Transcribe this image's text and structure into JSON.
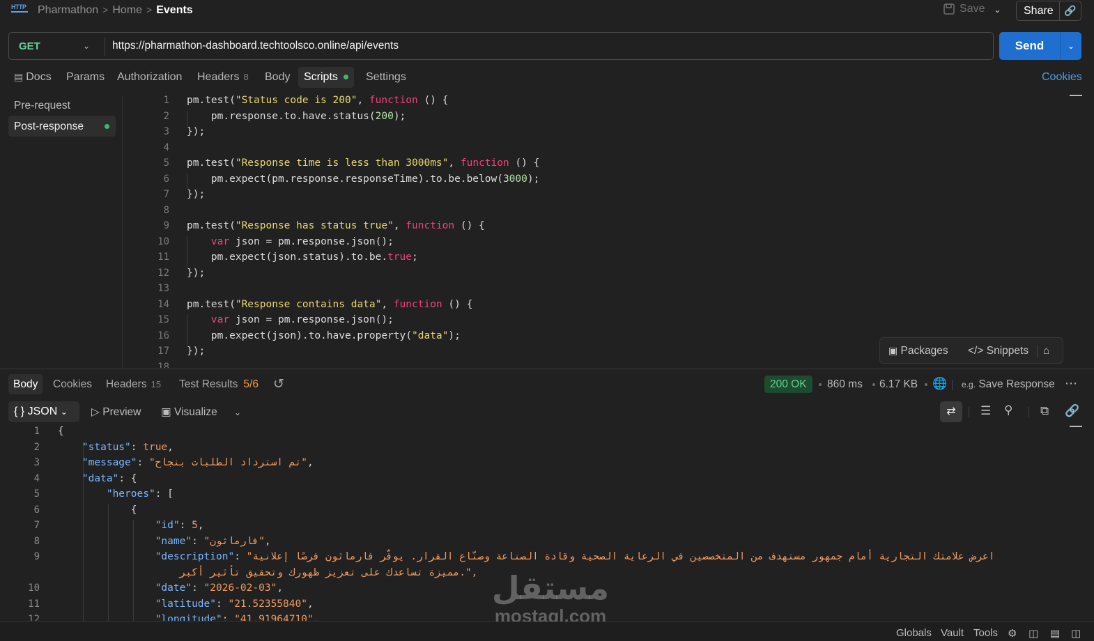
{
  "header": {
    "breadcrumb": [
      "Pharmathon",
      "Home",
      "Events"
    ],
    "save_label": "Save",
    "share_label": "Share"
  },
  "request": {
    "method": "GET",
    "url": "https://pharmathon-dashboard.techtoolsco.online/api/events",
    "send_label": "Send"
  },
  "tabs": {
    "docs": "Docs",
    "params": "Params",
    "authorization": "Authorization",
    "headers": "Headers",
    "headers_count": "8",
    "body": "Body",
    "scripts": "Scripts",
    "settings": "Settings",
    "cookies": "Cookies"
  },
  "scripts_sidebar": {
    "pre": "Pre-request",
    "post": "Post-response"
  },
  "editor_tools": {
    "packages": "Packages",
    "snippets": "Snippets"
  },
  "code_lines": [
    {
      "n": "1",
      "text": "pm.test(\"Status code is 200\", function () {"
    },
    {
      "n": "2",
      "text": "    pm.response.to.have.status(200);"
    },
    {
      "n": "3",
      "text": "});"
    },
    {
      "n": "4",
      "text": ""
    },
    {
      "n": "5",
      "text": "pm.test(\"Response time is less than 3000ms\", function () {"
    },
    {
      "n": "6",
      "text": "    pm.expect(pm.response.responseTime).to.be.below(3000);"
    },
    {
      "n": "7",
      "text": "});"
    },
    {
      "n": "8",
      "text": ""
    },
    {
      "n": "9",
      "text": "pm.test(\"Response has status true\", function () {"
    },
    {
      "n": "10",
      "text": "    var json = pm.response.json();"
    },
    {
      "n": "11",
      "text": "    pm.expect(json.status).to.be.true;"
    },
    {
      "n": "12",
      "text": "});"
    },
    {
      "n": "13",
      "text": ""
    },
    {
      "n": "14",
      "text": "pm.test(\"Response contains data\", function () {"
    },
    {
      "n": "15",
      "text": "    var json = pm.response.json();"
    },
    {
      "n": "16",
      "text": "    pm.expect(json).to.have.property(\"data\");"
    },
    {
      "n": "17",
      "text": "});"
    },
    {
      "n": "18",
      "text": ""
    }
  ],
  "response": {
    "tabs": {
      "body": "Body",
      "cookies": "Cookies",
      "headers": "Headers",
      "headers_count": "15",
      "test_results": "Test Results",
      "test_count": "5/6"
    },
    "status": "200 OK",
    "time": "860 ms",
    "size": "6.17 KB",
    "save_response": "Save Response",
    "format": "JSON",
    "preview": "Preview",
    "visualize": "Visualize"
  },
  "json_lines": [
    {
      "n": "1",
      "text": "{"
    },
    {
      "n": "2",
      "text": "    \"status\": true,"
    },
    {
      "n": "3",
      "text": "    \"message\": \"تم استرداد الطلبات بنجاح\","
    },
    {
      "n": "4",
      "text": "    \"data\": {"
    },
    {
      "n": "5",
      "text": "        \"heroes\": ["
    },
    {
      "n": "6",
      "text": "            {"
    },
    {
      "n": "7",
      "text": "                \"id\": 5,"
    },
    {
      "n": "8",
      "text": "                \"name\": \"فارماثون\","
    },
    {
      "n": "9",
      "text": "                \"description\": \"اعرض علامتك التجارية أمام جمهور مستهدف من المتخصصين في الرعاية الصحية وقادة الصناعة وصنّاع القرار. يوفّر فارماثون فرصًا إعلانية"
    },
    {
      "n": "",
      "text": "                    مميزة تساعدك على تعزيز ظهورك وتحقيق تأثير أكبر.\","
    },
    {
      "n": "10",
      "text": "                \"date\": \"2026-02-03\","
    },
    {
      "n": "11",
      "text": "                \"latitude\": \"21.52355840\","
    },
    {
      "n": "12",
      "text": "                \"longitude\": \"41.91964710\","
    }
  ],
  "watermark": {
    "arabic": "مستقل",
    "latin": "mostaql.com"
  },
  "statusbar": {
    "globals": "Globals",
    "vault": "Vault",
    "tools": "Tools"
  },
  "colors": {
    "accent": "#1f6fd1",
    "method_get": "#6bd09b",
    "status_ok": "#5ed68e",
    "test_warn": "#f0a04b"
  }
}
